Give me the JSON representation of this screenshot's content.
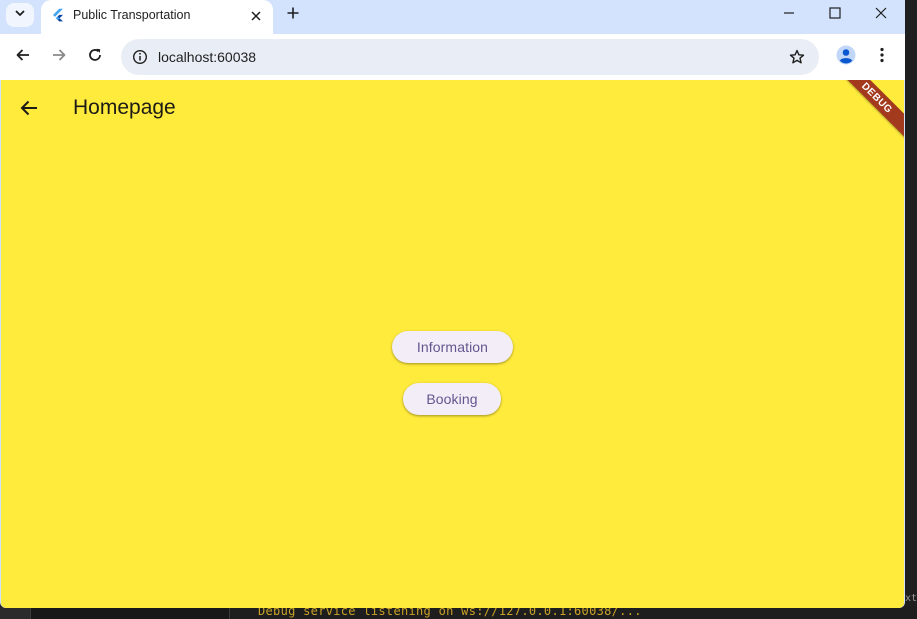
{
  "browser": {
    "tab": {
      "title": "Public Transportation"
    },
    "address_bar": {
      "url": "localhost:60038"
    }
  },
  "app": {
    "appbar": {
      "title": "Homepage"
    },
    "buttons": {
      "information": "Information",
      "booking": "Booking"
    },
    "debug_banner": "DEBUG",
    "background_color": "#ffeb3b",
    "button_color": "#f3edf7",
    "button_text_color": "#65558f"
  },
  "background_ide": {
    "console_text": "Debug service listening on ws://127.0.0.1:60038/...",
    "side_text": "xt"
  },
  "icons": {
    "tab_search": "chevron-down-icon",
    "favicon": "flutter-icon",
    "tab_close": "close-icon",
    "new_tab": "plus-icon",
    "back": "arrow-left-icon",
    "forward": "arrow-right-icon",
    "reload": "reload-icon",
    "site_info": "info-icon",
    "bookmark": "star-icon",
    "profile": "profile-icon",
    "menu": "kebab-menu-icon"
  }
}
